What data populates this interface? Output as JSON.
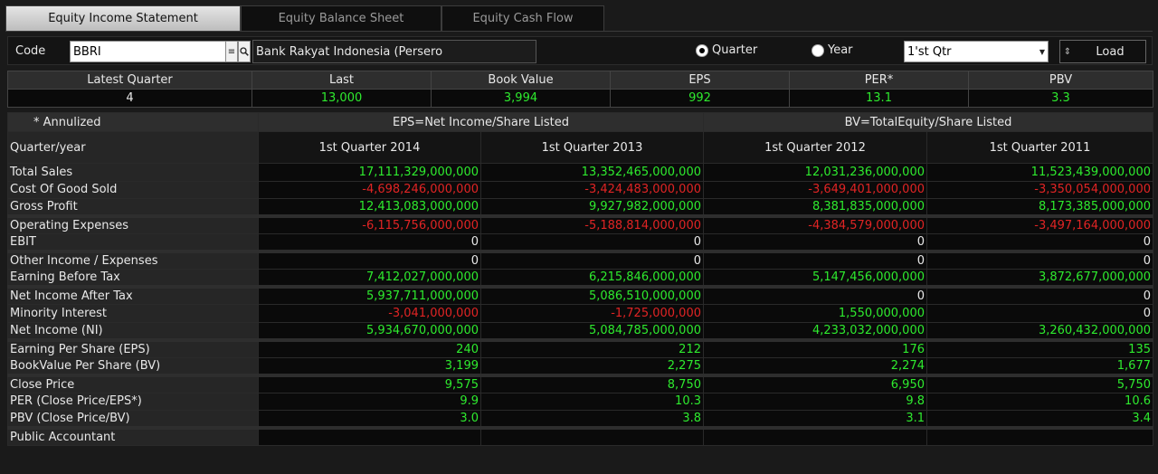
{
  "tabs": [
    {
      "label": "Equity Income Statement",
      "active": true
    },
    {
      "label": "Equity Balance Sheet",
      "active": false
    },
    {
      "label": "Equity Cash Flow",
      "active": false
    }
  ],
  "toolbar": {
    "code_label": "Code",
    "code_value": "BBRI",
    "company_name": "Bank Rakyat Indonesia (Persero",
    "radio_quarter": "Quarter",
    "radio_year": "Year",
    "selected_period": "quarter",
    "quarter_select": "1'st Qtr",
    "load_label": "Load"
  },
  "summary": {
    "headers": [
      "Latest Quarter",
      "Last",
      "Book Value",
      "EPS",
      "PER*",
      "PBV"
    ],
    "values": [
      "4",
      "13,000",
      "3,994",
      "992",
      "13.1",
      "3.3"
    ]
  },
  "table": {
    "annualized_note": "*    Annulized",
    "eps_formula": "EPS=Net Income/Share Listed",
    "bv_formula": "BV=TotalEquity/Share Listed",
    "row_header": "Quarter/year",
    "columns": [
      "1st Quarter 2014",
      "1st Quarter 2013",
      "1st Quarter 2012",
      "1st Quarter 2011"
    ],
    "rows": [
      {
        "label": "Total Sales",
        "values": [
          "17,111,329,000,000",
          "13,352,465,000,000",
          "12,031,236,000,000",
          "11,523,439,000,000"
        ],
        "section_start": false
      },
      {
        "label": "Cost Of Good Sold",
        "values": [
          "-4,698,246,000,000",
          "-3,424,483,000,000",
          "-3,649,401,000,000",
          "-3,350,054,000,000"
        ],
        "section_start": false
      },
      {
        "label": "Gross Profit",
        "values": [
          "12,413,083,000,000",
          "9,927,982,000,000",
          "8,381,835,000,000",
          "8,173,385,000,000"
        ],
        "section_start": false
      },
      {
        "label": "Operating Expenses",
        "values": [
          "-6,115,756,000,000",
          "-5,188,814,000,000",
          "-4,384,579,000,000",
          "-3,497,164,000,000"
        ],
        "section_start": true
      },
      {
        "label": "EBIT",
        "values": [
          "0",
          "0",
          "0",
          "0"
        ],
        "section_start": false
      },
      {
        "label": "Other Income / Expenses",
        "values": [
          "0",
          "0",
          "0",
          "0"
        ],
        "section_start": true
      },
      {
        "label": "Earning Before Tax",
        "values": [
          "7,412,027,000,000",
          "6,215,846,000,000",
          "5,147,456,000,000",
          "3,872,677,000,000"
        ],
        "section_start": false
      },
      {
        "label": "Net Income After Tax",
        "values": [
          "5,937,711,000,000",
          "5,086,510,000,000",
          "0",
          "0"
        ],
        "section_start": true
      },
      {
        "label": "Minority Interest",
        "values": [
          "-3,041,000,000",
          "-1,725,000,000",
          "1,550,000,000",
          "0"
        ],
        "section_start": false
      },
      {
        "label": "Net Income (NI)",
        "values": [
          "5,934,670,000,000",
          "5,084,785,000,000",
          "4,233,032,000,000",
          "3,260,432,000,000"
        ],
        "section_start": false
      },
      {
        "label": "Earning Per Share (EPS)",
        "values": [
          "240",
          "212",
          "176",
          "135"
        ],
        "section_start": true
      },
      {
        "label": "BookValue Per Share (BV)",
        "values": [
          "3,199",
          "2,275",
          "2,274",
          "1,677"
        ],
        "section_start": false
      },
      {
        "label": "Close Price",
        "values": [
          "9,575",
          "8,750",
          "6,950",
          "5,750"
        ],
        "section_start": true
      },
      {
        "label": "PER (Close Price/EPS*)",
        "values": [
          "9.9",
          "10.3",
          "9.8",
          "10.6"
        ],
        "section_start": false
      },
      {
        "label": "PBV (Close Price/BV)",
        "values": [
          "3.0",
          "3.8",
          "3.1",
          "3.4"
        ],
        "section_start": false
      },
      {
        "label": "Public Accountant",
        "values": [
          "",
          "",
          "",
          ""
        ],
        "section_start": true
      }
    ]
  },
  "colors": {
    "positive": "#2eea2e",
    "negative": "#e02424",
    "neutral": "#e8e8e8",
    "background": "#1a1a1a"
  }
}
